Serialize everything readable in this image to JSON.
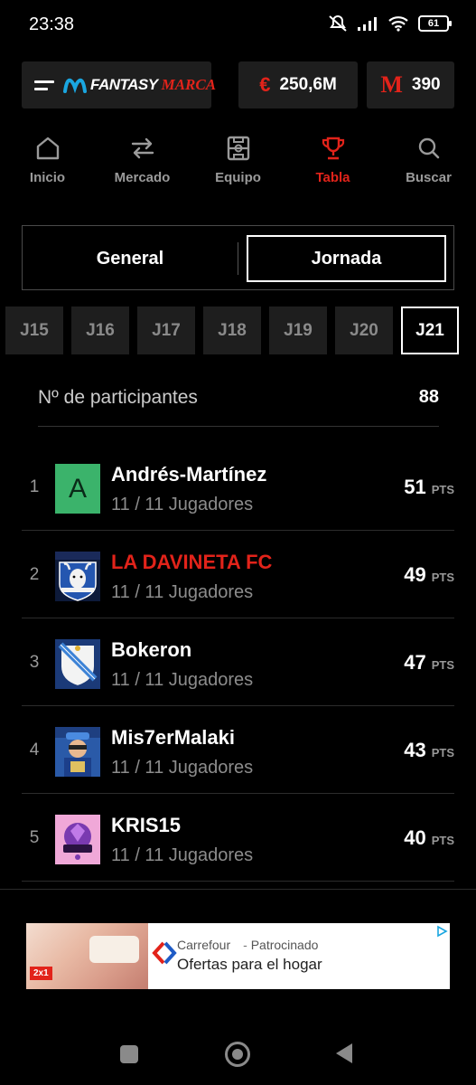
{
  "status_bar": {
    "time": "23:38",
    "battery": "61"
  },
  "header": {
    "brand_main": "FANTASY",
    "brand_accent": "MARCA",
    "balance": "250,6M",
    "points": "390",
    "accent_color": "#e2231a"
  },
  "nav": {
    "items": [
      {
        "label": "Inicio",
        "icon": "home-icon"
      },
      {
        "label": "Mercado",
        "icon": "transfer-arrows-icon"
      },
      {
        "label": "Equipo",
        "icon": "pitch-icon"
      },
      {
        "label": "Tabla",
        "icon": "trophy-icon",
        "active": true
      },
      {
        "label": "Buscar",
        "icon": "search-icon"
      }
    ]
  },
  "segmented": {
    "general": "General",
    "jornada": "Jornada",
    "selected": "Jornada"
  },
  "rounds": [
    "J15",
    "J16",
    "J17",
    "J18",
    "J19",
    "J20",
    "J21"
  ],
  "selected_round": "J21",
  "participants": {
    "label": "Nº de participantes",
    "count": "88"
  },
  "standings": [
    {
      "rank": "1",
      "name": "Andrés-Martínez",
      "players": "11 / 11 Jugadores",
      "points": "51",
      "unit": "PTS",
      "avatar_letter": "A"
    },
    {
      "rank": "2",
      "name": "LA DAVINETA FC",
      "players": "11 / 11 Jugadores",
      "points": "49",
      "unit": "PTS",
      "highlight": true
    },
    {
      "rank": "3",
      "name": "Bokeron",
      "players": "11 / 11 Jugadores",
      "points": "47",
      "unit": "PTS"
    },
    {
      "rank": "4",
      "name": "Mis7erMalaki",
      "players": "11 / 11 Jugadores",
      "points": "43",
      "unit": "PTS"
    },
    {
      "rank": "5",
      "name": "KRIS15",
      "players": "11 / 11 Jugadores",
      "points": "40",
      "unit": "PTS"
    }
  ],
  "ad": {
    "advertiser": "Carrefour",
    "sponsored": "Patrocinado",
    "headline": "Ofertas para el hogar",
    "badge": "2x1"
  }
}
